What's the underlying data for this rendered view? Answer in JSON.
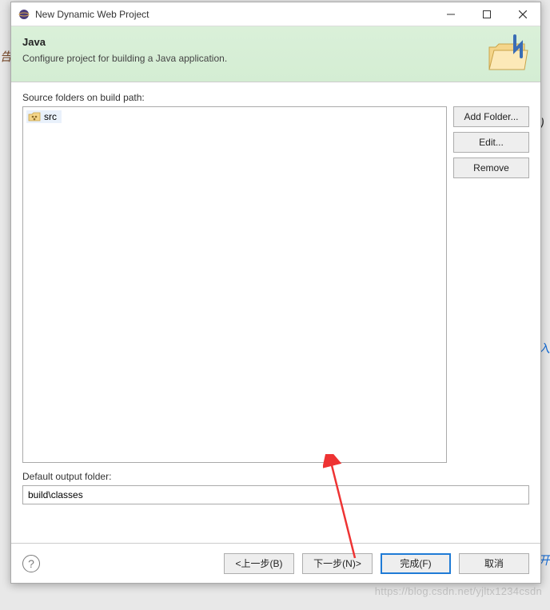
{
  "window": {
    "title": "New Dynamic Web Project"
  },
  "banner": {
    "title": "Java",
    "subtitle": "Configure project for building a Java application."
  },
  "sourceFolders": {
    "label": "Source folders on build path:",
    "items": [
      "src"
    ]
  },
  "sideButtons": {
    "addFolder": "Add Folder...",
    "edit": "Edit...",
    "remove": "Remove"
  },
  "outputFolder": {
    "label": "Default output folder:",
    "value": "build\\classes"
  },
  "footer": {
    "back": "<上一步(B)",
    "next": "下一步(N)>",
    "finish": "完成(F)",
    "cancel": "取消"
  },
  "watermark": "https://blog.csdn.net/yjltx1234csdn",
  "bgFragments": {
    "f1": "加入",
    "f2": "离开"
  }
}
